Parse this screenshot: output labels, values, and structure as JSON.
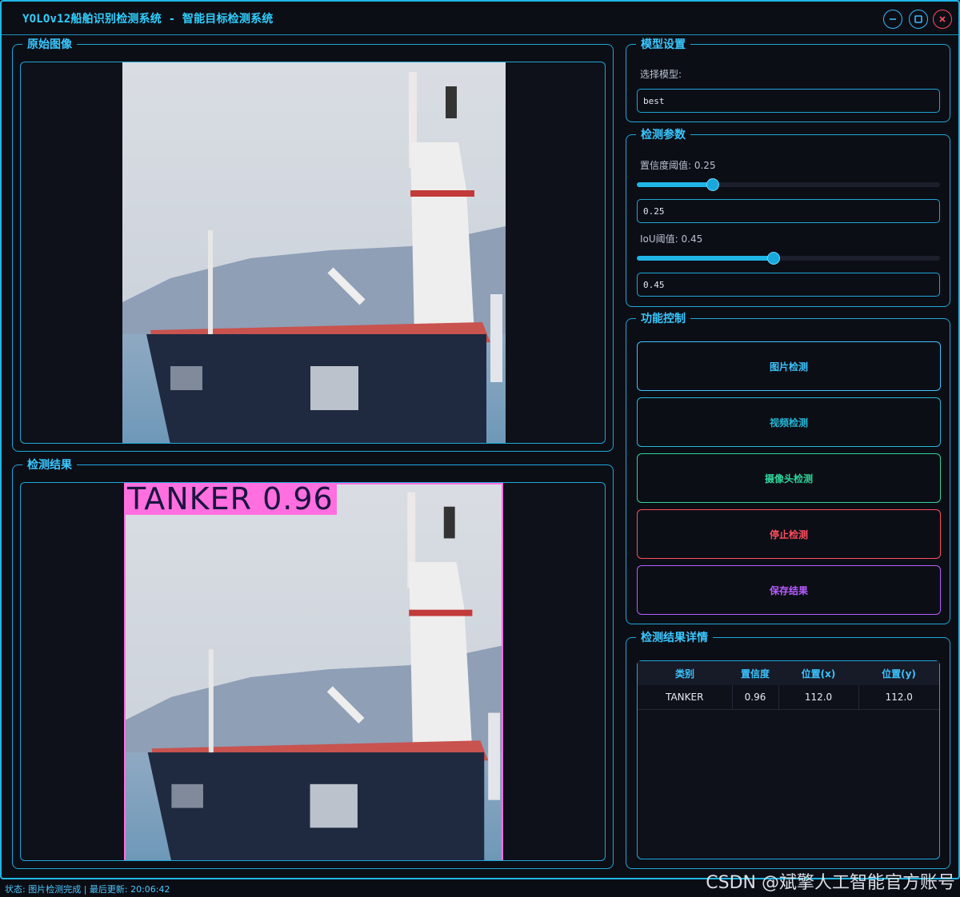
{
  "window": {
    "title": "YOLOv12船舶识别检测系统 - 智能目标检测系统",
    "controls": [
      "minimize-icon",
      "maximize-icon",
      "close-icon"
    ]
  },
  "panels": {
    "original": {
      "title": "原始图像"
    },
    "result": {
      "title": "检测结果",
      "detection_label": "TANKER 0.96",
      "box_color": "#ff6fe0"
    }
  },
  "model_settings": {
    "title": "模型设置",
    "select_label": "选择模型:",
    "selected_model": "best"
  },
  "detection_params": {
    "title": "检测参数",
    "confidence_label": "置信度阈值: 0.25",
    "confidence_value": "0.25",
    "confidence_fraction": 0.25,
    "iou_label": "IoU阈值: 0.45",
    "iou_value": "0.45",
    "iou_fraction": 0.45
  },
  "controls": {
    "title": "功能控制",
    "buttons": [
      {
        "label": "图片检测",
        "color": "#3bc4ff"
      },
      {
        "label": "视频检测",
        "color": "#25b8d8"
      },
      {
        "label": "摄像头检测",
        "color": "#2fd49a"
      },
      {
        "label": "停止检测",
        "color": "#ff4d5e"
      },
      {
        "label": "保存结果",
        "color": "#b65cff"
      }
    ]
  },
  "results": {
    "title": "检测结果详情",
    "columns": [
      "类别",
      "置信度",
      "位置(x)",
      "位置(y)"
    ],
    "rows": [
      [
        "TANKER",
        "0.96",
        "112.0",
        "112.0"
      ]
    ]
  },
  "status": "状态: 图片检测完成 | 最后更新: 20:06:42",
  "watermark": "CSDN @斌擎人工智能官方账号"
}
